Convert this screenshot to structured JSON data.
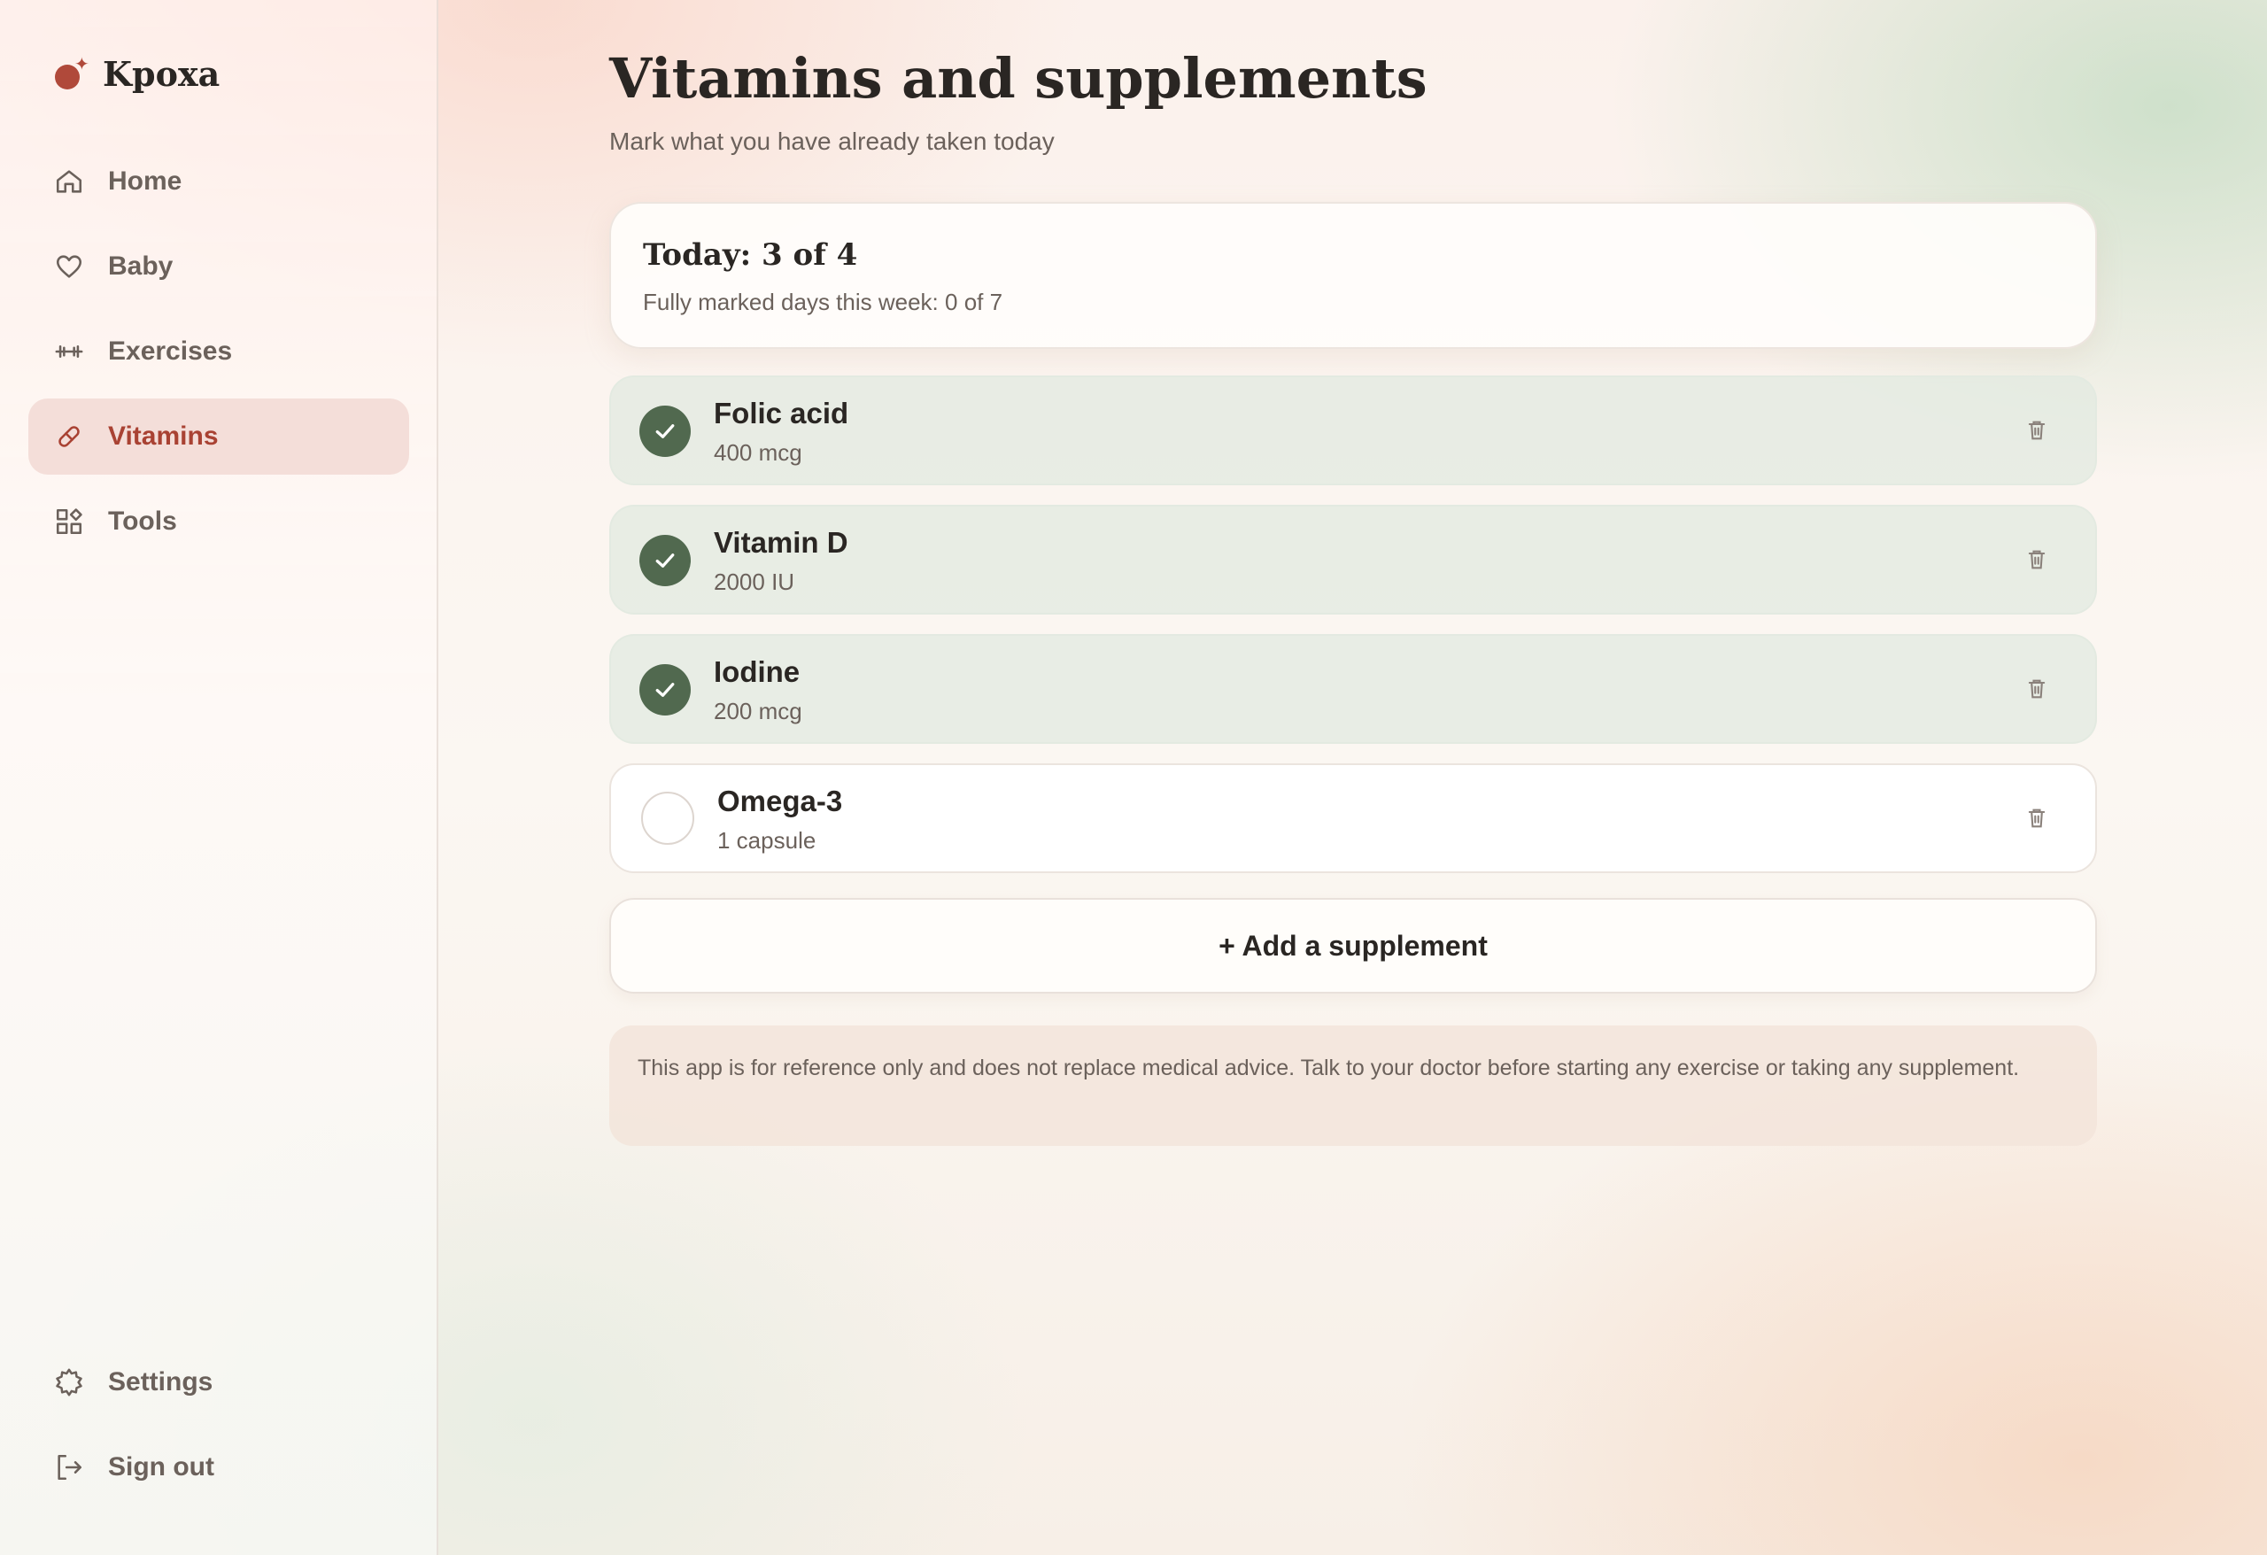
{
  "brand": {
    "name": "Kpoxa",
    "accent": "#b0493a"
  },
  "nav": {
    "items": [
      {
        "label": "Home",
        "icon": "home-icon",
        "active": false
      },
      {
        "label": "Baby",
        "icon": "heart-icon",
        "active": false
      },
      {
        "label": "Exercises",
        "icon": "dumbbell-icon",
        "active": false
      },
      {
        "label": "Vitamins",
        "icon": "pill-icon",
        "active": true
      },
      {
        "label": "Tools",
        "icon": "tools-icon",
        "active": false
      }
    ],
    "bottom": [
      {
        "label": "Settings",
        "icon": "gear-icon"
      },
      {
        "label": "Sign out",
        "icon": "sign-out-icon"
      }
    ]
  },
  "page": {
    "title": "Vitamins and supplements",
    "subtitle": "Mark what you have already taken today"
  },
  "summary": {
    "title": "Today: 3 of 4",
    "subtitle": "Fully marked days this week: 0 of 7"
  },
  "supplements": [
    {
      "name": "Folic acid",
      "dose": "400 mcg",
      "taken": true
    },
    {
      "name": "Vitamin D",
      "dose": "2000 IU",
      "taken": true
    },
    {
      "name": "Iodine",
      "dose": "200 mcg",
      "taken": true
    },
    {
      "name": "Omega-3",
      "dose": "1 capsule",
      "taken": false
    }
  ],
  "add_button": {
    "label": "+ Add a supplement"
  },
  "disclaimer": "This app is for reference only and does not replace medical advice. Talk to your doctor before starting any exercise or taking any supplement.",
  "colors": {
    "checked_green": "#51694f",
    "active_nav": "#a94233",
    "muted_text": "#6b615b"
  }
}
